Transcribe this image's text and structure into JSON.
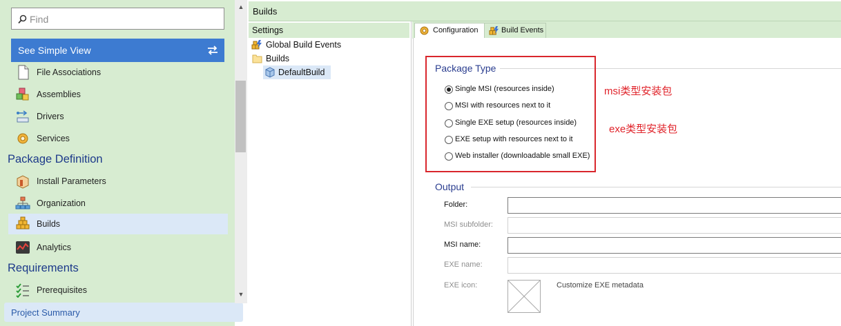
{
  "sidebar": {
    "search_placeholder": "Find",
    "simple_view_label": "See Simple View",
    "items_top": [
      {
        "label": "File Associations",
        "icon": "file-associations-icon"
      },
      {
        "label": "Assemblies",
        "icon": "assemblies-icon"
      },
      {
        "label": "Drivers",
        "icon": "drivers-icon"
      },
      {
        "label": "Services",
        "icon": "services-icon"
      }
    ],
    "section_package": "Package Definition",
    "items_package": [
      {
        "label": "Install Parameters",
        "icon": "install-parameters-icon"
      },
      {
        "label": "Organization",
        "icon": "organization-icon"
      },
      {
        "label": "Builds",
        "icon": "builds-icon",
        "selected": true
      },
      {
        "label": "Analytics",
        "icon": "analytics-icon"
      }
    ],
    "section_requirements": "Requirements",
    "items_requirements": [
      {
        "label": "Prerequisites",
        "icon": "prerequisites-icon"
      }
    ],
    "project_summary": "Project Summary"
  },
  "header": {
    "title": "Builds"
  },
  "tree": {
    "header": "Settings",
    "nodes": [
      {
        "label": "Global Build Events"
      },
      {
        "label": "Builds"
      },
      {
        "label": "DefaultBuild"
      }
    ]
  },
  "tabs": [
    {
      "label": "Configuration",
      "active": true
    },
    {
      "label": "Build Events",
      "active": false
    }
  ],
  "config": {
    "package_type_title": "Package Type",
    "options": [
      {
        "label": "Single MSI (resources inside)",
        "checked": true
      },
      {
        "label": "MSI with resources next to it",
        "checked": false
      },
      {
        "label": "Single EXE setup (resources inside)",
        "checked": false
      },
      {
        "label": "EXE setup with resources next to it",
        "checked": false
      },
      {
        "label": "Web installer (downloadable small EXE)",
        "checked": false
      }
    ],
    "output_title": "Output",
    "fields": [
      {
        "label": "Folder:",
        "enabled": true,
        "value": ""
      },
      {
        "label": "MSI subfolder:",
        "enabled": false,
        "value": ""
      },
      {
        "label": "MSI name:",
        "enabled": true,
        "value": ""
      },
      {
        "label": "EXE name:",
        "enabled": false,
        "value": ""
      }
    ],
    "exe_icon_label": "EXE icon:",
    "customize_exe_label": "Customize EXE metadata"
  },
  "annotations": {
    "msi": "msi类型安装包",
    "exe": "exe类型安装包"
  },
  "colors": {
    "nav_bg": "#d7ecd1",
    "accent_blue": "#3d7bd1",
    "selected_bg": "#dbe8f7",
    "section_title": "#1d3a8a",
    "annotation_red": "#e0232a"
  }
}
